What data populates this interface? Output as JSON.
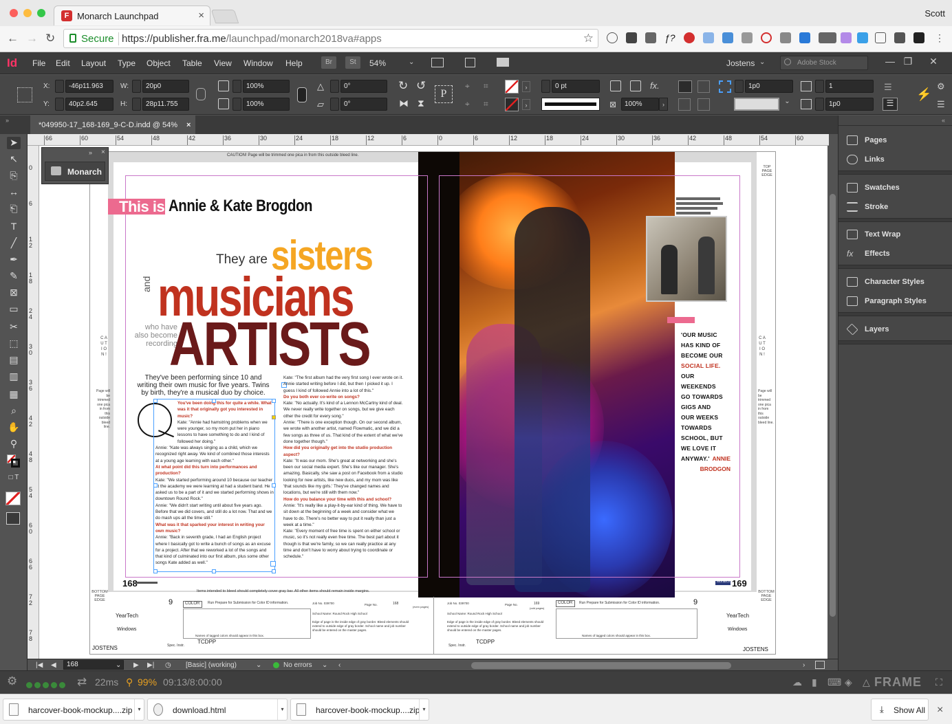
{
  "browser": {
    "tab_title": "Monarch Launchpad",
    "tab_close": "×",
    "user": "Scott",
    "secure_label": "Secure",
    "url_base": "https://publisher.fra.me",
    "url_path": "/launchpad/monarch2018va#apps",
    "star": "☆"
  },
  "indesign": {
    "logo": "Id",
    "menu": [
      "File",
      "Edit",
      "Layout",
      "Type",
      "Object",
      "Table",
      "View",
      "Window",
      "Help"
    ],
    "bridge_btn": "Br",
    "stock_btn": "St",
    "zoom": "54%",
    "workspace": "Jostens",
    "stock_search_placeholder": "Adobe Stock",
    "control": {
      "x_label": "X:",
      "x_value": "-46p11.963",
      "y_label": "Y:",
      "y_value": "40p2.645",
      "w_label": "W:",
      "w_value": "20p0",
      "h_label": "H:",
      "h_value": "28p11.755",
      "scale_x": "100%",
      "scale_y": "100%",
      "rotate": "0°",
      "shear": "0°",
      "stroke_weight": "0 pt",
      "opacity": "100%",
      "gap_1": "1p0",
      "columns": "1",
      "gap_2": "1p0"
    },
    "doc_tab": "*049950-17_168-169_9-C-D.indd @ 54%",
    "doc_tab_close": "×",
    "ruler_h": [
      "66",
      "60",
      "54",
      "48",
      "42",
      "36",
      "30",
      "24",
      "18",
      "12",
      "6",
      "0",
      "6",
      "12",
      "18",
      "24",
      "30",
      "36",
      "42",
      "48",
      "54",
      "60",
      "6"
    ],
    "ruler_v": [
      "0",
      "6",
      "1 2",
      "1 8",
      "2 4",
      "3 0",
      "3 6",
      "4 2",
      "4 8",
      "5 4",
      "6 0",
      "6 6",
      "7 2",
      "7 8"
    ],
    "monarch_panel": {
      "label": "Monarch"
    },
    "right_panels": [
      {
        "label": "Pages",
        "icon": "pages-icon"
      },
      {
        "label": "Links",
        "icon": "links-icon"
      },
      {
        "label": "Swatches",
        "icon": "swatches-icon"
      },
      {
        "label": "Stroke",
        "icon": "stroke-icon"
      },
      {
        "label": "Text Wrap",
        "icon": "text-wrap-icon"
      },
      {
        "label": "Effects",
        "icon": "effects-icon"
      },
      {
        "label": "Character Styles",
        "icon": "character-styles-icon"
      },
      {
        "label": "Paragraph Styles",
        "icon": "paragraph-styles-icon"
      },
      {
        "label": "Layers",
        "icon": "layers-icon"
      }
    ],
    "status": {
      "page": "168",
      "style": "[Basic] (working)",
      "preflight": "No errors"
    }
  },
  "layout": {
    "caution_top": "CAUTION! Page will be trimmed one pica in from this outside bleed line.",
    "top_edge": "TOP PAGE EDGE",
    "bottom_edge": "BOTTOM PAGE EDGE",
    "this_is": "This is",
    "name": "Annie & Kate Brogdon",
    "they_are": "They are",
    "sisters": "sisters",
    "and": "and",
    "musicians": "musicians",
    "who_have": "who have also become recording",
    "artists": "ARTISTS",
    "dek": "They've been performing since 10 and writing their own music for five years. Twins by birth, they're a musical duo by choice.",
    "col1": [
      {
        "q": true,
        "t": "You've been doing this for quite a while. What was it that originally got you interested in music?"
      },
      {
        "q": false,
        "t": "Kate: \"Annie had hamstring problems when we were younger, so my mom put her in piano lessons to have something to do and I kind of followed her doing.\""
      },
      {
        "q": false,
        "t": "Annie: \"Kate was always singing as a child, which we recognized right away. We kind of combined those interests at a young age learning with each other.\""
      },
      {
        "q": true,
        "t": "At what point did this turn into performances and production?"
      },
      {
        "q": false,
        "t": "Kate: \"We started performing around 10 because our teacher at the academy we were learning at had a student band. He asked us to be a part of it and we started performing shows in downtown Round Rock.\""
      },
      {
        "q": false,
        "t": "Annie: \"We didn't start writing until about five years ago. Before that we did covers, and still do a lot now. That and we do mash ups all the time still.\""
      },
      {
        "q": true,
        "t": "What was it that sparked your interest in writing your own music?"
      },
      {
        "q": false,
        "t": "Annie: \"Back in seventh grade, I had an English project where I basically got to write a bunch of songs as an excuse for a project. After that we reworked a lot of the songs and that kind of culminated into our first album, plus some other songs Kate added as well.\""
      }
    ],
    "col2": [
      {
        "q": false,
        "t": "Kate: \"The first album had the very first song I ever wrote on it. Annie started writing before I did, but then I picked it up. I guess I kind of followed Annie into a lot of this.\""
      },
      {
        "q": true,
        "t": "Do you both ever co-write on songs?"
      },
      {
        "q": false,
        "t": "Kate: \"No actually. It's kind of a Lennon McCartny kind of deal. We never really write together on songs, but we give each other the credit for every song.\""
      },
      {
        "q": false,
        "t": "Annie: \"There is one exception though. On our second album, we wrote with another artist, named Flowmatic, and we did a few songs as three of us. That kind of the extent of what we've done together though.\""
      },
      {
        "q": true,
        "t": "How did you originally get into the studio production aspect?"
      },
      {
        "q": false,
        "t": "Kate: \"It was our mom. She's great at networking and she's been our social media expert. She's like our manager. She's amazing. Basically, she saw a post on Facebook from a studio looking for new artists, like new duos, and my mom was like 'that sounds like my girls.' They've changed names and locations, but we're still with them now.\""
      },
      {
        "q": true,
        "t": "How do you balance your time with this and school?"
      },
      {
        "q": false,
        "t": "Annie: \"It's really like a play-it-by-ear kind of thing. We have to sit down at the beginning of a week and consider what we have to do. There's no better way to put it really than just a week at a time.\""
      },
      {
        "q": false,
        "t": "Kate: \"Every moment of free time is spent on either school or music, so it's not really even free time. The best part about it though is that we're family, so we can really practice at any time and don't have to worry about trying to coordinate or schedule.\""
      }
    ],
    "pull_quote": [
      "'OUR MUSIC",
      "HAS KIND OF",
      "BECOME OUR"
    ],
    "pull_quote_pink": "SOCIAL LIFE.",
    "pull_quote_rest": [
      "OUR WEEKENDS",
      "GO TOWARDS",
      "GIGS AND",
      "OUR WEEKS",
      "TOWARDS",
      "SCHOOL, BUT",
      "WE LOVE IT",
      "ANYWAY.'"
    ],
    "pull_by": [
      "ANNIE",
      "BRODGON"
    ],
    "page_left": "168",
    "page_right": "169",
    "monarch_tab": "Monarch",
    "bleed_note": "Items intended to bleed should completely cover gray bar. All other items should remain inside margins.",
    "caution_side": "C A U T I O N !",
    "caution_side_text": "Page will be trimmed one pica in from this outside bleed line.",
    "slug_left": {
      "num": "9",
      "color": "COLOR",
      "run": "Run Prepare for Submission for Color ID information.",
      "jobno": "Job No. 039700",
      "pageno": "Page No.",
      "pagenum": "168",
      "evenpage": "(even pages)",
      "school": "School Name: Round Rock High School",
      "edge": "Edge of page is the inside edge of gray border. Bleed elements should extend to outside edge of gray border. School name and job number should be entered on the master pages.",
      "yeartech": "YearTech",
      "windows": "Windows",
      "tagged": "Names of tagged colors should appear in this box.",
      "spec": "Spec. Instr.",
      "tcdpp": "TCDPP",
      "jostens": "JOSTENS"
    },
    "slug_right": {
      "num": "9",
      "color": "COLOR",
      "run": "Run Prepare for Submission for Color ID information.",
      "jobno": "Job No. 039700",
      "pageno": "Page No.",
      "pagenum": "169",
      "oddpage": "(odd pages)",
      "school": "School Name: Round Rock High School",
      "edge": "Edge of page is the inside edge of gray border. Bleed elements should extend to outside edge of gray border. School name and job number should be entered on the master pages.",
      "yeartech": "YearTech",
      "windows": "Windows",
      "tagged": "Names of tagged colors should appear in this box.",
      "spec": "Spec. Instr.",
      "tcdpp": "TCDPP",
      "jostens": "JOSTENS"
    }
  },
  "frame": {
    "latency": "22ms",
    "quality": "99%",
    "time": "09:13/8:00:00",
    "brand": "FRAME"
  },
  "downloads": {
    "items": [
      "harcover-book-mockup....zip",
      "download.html",
      "harcover-book-mockup....zip"
    ],
    "show_all": "Show All",
    "close": "×"
  }
}
